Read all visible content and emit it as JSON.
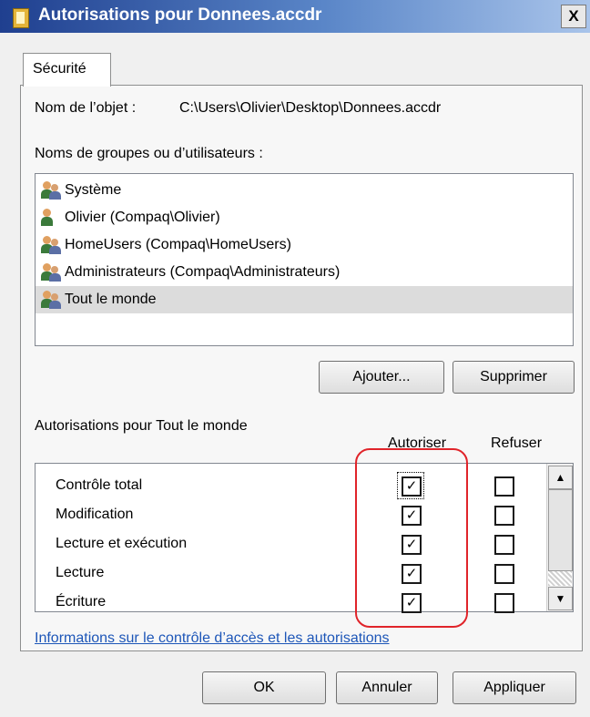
{
  "window": {
    "title": "Autorisations pour Donnees.accdr",
    "close_label": "X"
  },
  "tab": {
    "label": "Sécurité"
  },
  "object": {
    "label": "Nom de l’objet :",
    "path": "C:\\Users\\Olivier\\Desktop\\Donnees.accdr"
  },
  "groups": {
    "label": "Noms de groupes ou d’utilisateurs :",
    "items": [
      {
        "label": "Système",
        "icon": "users-icon"
      },
      {
        "label": "Olivier (Compaq\\Olivier)",
        "icon": "user-icon"
      },
      {
        "label": "HomeUsers (Compaq\\HomeUsers)",
        "icon": "users-icon"
      },
      {
        "label": "Administrateurs (Compaq\\Administrateurs)",
        "icon": "users-icon"
      },
      {
        "label": "Tout le monde",
        "icon": "users-icon",
        "selected": true
      }
    ]
  },
  "buttons": {
    "add": "Ajouter...",
    "remove": "Supprimer",
    "ok": "OK",
    "cancel": "Annuler",
    "apply": "Appliquer"
  },
  "permissions": {
    "label": "Autorisations pour Tout le monde",
    "allow_header": "Autoriser",
    "deny_header": "Refuser",
    "rows": [
      {
        "name": "Contrôle total",
        "allow": true,
        "deny": false
      },
      {
        "name": "Modification",
        "allow": true,
        "deny": false
      },
      {
        "name": "Lecture et exécution",
        "allow": true,
        "deny": false
      },
      {
        "name": "Lecture",
        "allow": true,
        "deny": false
      },
      {
        "name": "Écriture",
        "allow": true,
        "deny": false
      }
    ]
  },
  "link": "Informations sur le contrôle d’accès et les autorisations",
  "colors": {
    "highlight_ring": "#e0242a",
    "link": "#1d56b8",
    "selected_row": "#dcdcdc"
  }
}
